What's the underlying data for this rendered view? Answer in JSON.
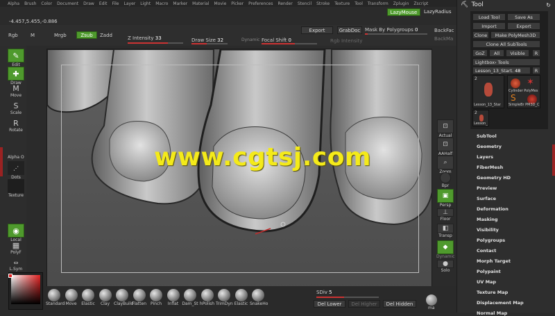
{
  "menu": [
    "Alpha",
    "Brush",
    "Color",
    "Document",
    "Draw",
    "Edit",
    "File",
    "Layer",
    "Light",
    "Macro",
    "Marker",
    "Material",
    "Movie",
    "Picker",
    "Preferences",
    "Render",
    "Stencil",
    "Stroke",
    "Texture",
    "Tool",
    "Transform",
    "Zplugin",
    "Zscript"
  ],
  "coords": "-4.457,5.455,-0.886",
  "topbar": {
    "rgb": "Rgb",
    "m": "M",
    "mrgb": "Mrgb",
    "zsub": "Zsub",
    "zadd": "Zadd",
    "z_intensity_label": "Z Intensity",
    "z_intensity": "33",
    "draw_size_label": "Draw Size",
    "draw_size": "32",
    "dynamic": "Dynamic",
    "focal_shift_label": "Focal Shift",
    "focal_shift": "0",
    "rgb_intensity": "Rgb Intensity",
    "export": "Export",
    "grabdoc": "GrabDoc",
    "mask_label": "Mask By Polygroups",
    "mask_value": "0",
    "lazymouse": "LazyMouse",
    "lazyradius": "LazyRadius",
    "backface": "BackFac",
    "backface2": "BackMa"
  },
  "left_tools": [
    {
      "name": "edit",
      "label": "Edit",
      "glyph": "✎"
    },
    {
      "name": "draw",
      "label": "Draw",
      "glyph": "✚"
    },
    {
      "name": "move",
      "label": "Move",
      "glyph": "M"
    },
    {
      "name": "scale",
      "label": "Scale",
      "glyph": "S"
    },
    {
      "name": "rotate",
      "label": "Rotate",
      "glyph": "R"
    }
  ],
  "alpha_label": "Alpha",
  "alpha_value": "O",
  "dots_label": "Dots",
  "texture_label": "Texture",
  "local_label": "Local",
  "polyf_label": "PolyF",
  "lsym_label": "L.Sym",
  "watermark": "www.cgtsj.com",
  "dock": [
    {
      "name": "actual",
      "label": "Actual",
      "glyph": "⊡"
    },
    {
      "name": "aahalf",
      "label": "AAHalf",
      "glyph": "⊡"
    },
    {
      "name": "zoom",
      "label": "Zoom",
      "glyph": "⌕"
    },
    {
      "name": "persp",
      "label": "Persp",
      "glyph": "▣"
    },
    {
      "name": "floor",
      "label": "Floor",
      "glyph": "⊥"
    },
    {
      "name": "transp",
      "label": "Transp",
      "glyph": "◧"
    },
    {
      "name": "solo",
      "label": "Solo",
      "glyph": "●"
    }
  ],
  "bpr_label": "Bpr",
  "dynamic_dock": "Dynamic",
  "brushes": [
    "Standard",
    "Move",
    "Elastic",
    "Clay",
    "ClayBuild",
    "Flatten",
    "Pinch",
    "Inflat",
    "Dam_St",
    "hPolish",
    "TrimDyn",
    "Elastic",
    "SnakeHo"
  ],
  "sdiv_label": "SDiv",
  "sdiv_value": "5",
  "del_lower": "Del Lower",
  "del_higher": "Del Higher",
  "del_hidden": "Del Hidden",
  "mat_label": "ma",
  "palette": {
    "title": "Tool",
    "load": "Load Tool",
    "save": "Save As",
    "import": "Import",
    "export": "Export",
    "clone": "Clone",
    "make": "Make PolyMesh3D",
    "clone_all": "Clone All SubTools",
    "goz": "GoZ",
    "all": "All",
    "visible": "Visible",
    "r": "R",
    "lightbox": "Lightbox› Tools",
    "current": "Lesson_13_Start.",
    "current_val": "48",
    "r2": "R",
    "thumbs": [
      {
        "label": "Lesson_13_Star",
        "count": "2"
      },
      {
        "label": "Cylinder PolyMes",
        "count": ""
      },
      {
        "label": "SimpleBr PM3D_C",
        "count": ""
      },
      {
        "label": "Lesson_",
        "count": "2"
      }
    ],
    "items": [
      "SubTool",
      "Geometry",
      "Layers",
      "FiberMesh",
      "Geometry HD",
      "Preview",
      "Surface",
      "Deformation",
      "Masking",
      "Visibility",
      "Polygroups",
      "Contact",
      "Morph Target",
      "Polypaint",
      "UV Map",
      "Texture Map",
      "Displacement Map",
      "Normal Map"
    ]
  }
}
